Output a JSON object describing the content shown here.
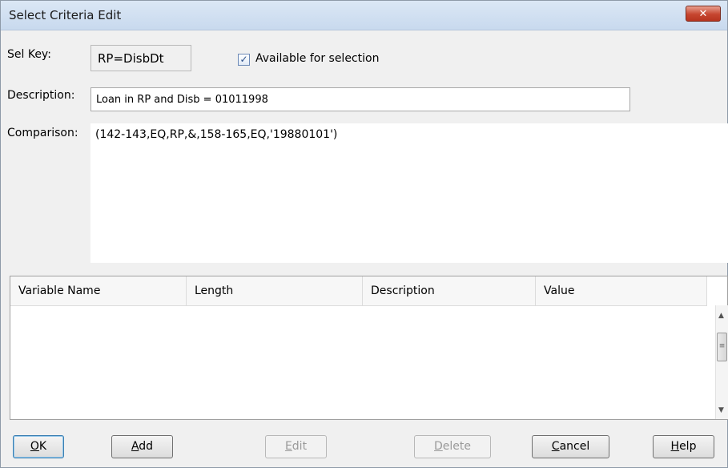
{
  "window": {
    "title": "Select Criteria Edit",
    "close_glyph": "✕"
  },
  "form": {
    "sel_key_label": "Sel Key:",
    "sel_key_value": "RP=DisbDt",
    "available_checked": true,
    "available_label": "Available for selection",
    "description_label": "Description:",
    "description_value": "Loan in RP and Disb = 01011998",
    "comparison_label": "Comparison:",
    "comparison_value": "(142-143,EQ,RP,&,158-165,EQ,'19880101')"
  },
  "grid": {
    "columns": [
      "Variable Name",
      "Length",
      "Description",
      "Value"
    ],
    "rows": []
  },
  "buttons": {
    "ok": {
      "first": "O",
      "rest": "K",
      "enabled": true
    },
    "add": {
      "first": "A",
      "rest": "dd",
      "enabled": true
    },
    "edit": {
      "first": "E",
      "rest": "dit",
      "enabled": false
    },
    "delete": {
      "first": "D",
      "rest": "elete",
      "enabled": false
    },
    "cancel": {
      "first": "C",
      "rest": "ancel",
      "enabled": true
    },
    "help": {
      "first": "H",
      "rest": "elp",
      "enabled": true
    }
  }
}
